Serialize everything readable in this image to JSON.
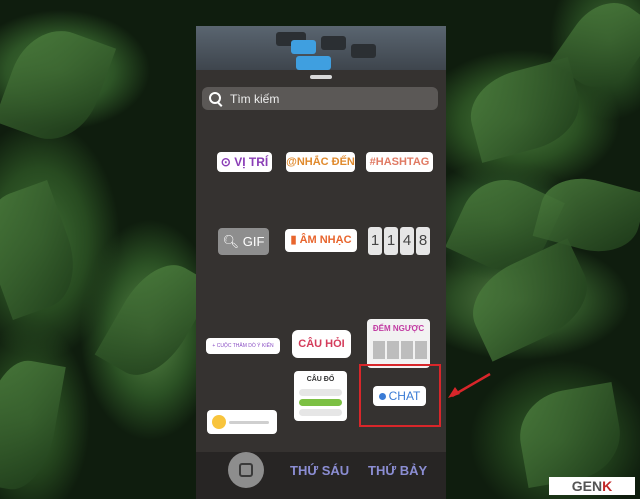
{
  "search": {
    "placeholder": "Tìm kiếm"
  },
  "stickers": {
    "location": "VỊ TRÍ",
    "mention": "@NHẮC ĐẾN",
    "hashtag": "#HASHTAG",
    "gif": "GIF",
    "music": "ÂM NHẠC",
    "countdown_digits": [
      "1",
      "1",
      "4",
      "8"
    ],
    "poll": "+ CUỘC THĂM DÒ Ý KIẾN",
    "question": "CÂU HỎI",
    "quiz_title": "ĐẾM NGƯỢC",
    "quiz2_title": "CÂU ĐỐ",
    "chat": "CHAT"
  },
  "bottom_bar": {
    "days": [
      "THỨ SÁU",
      "THỨ BẢY"
    ]
  },
  "watermark": {
    "brand_prefix": "GEN",
    "brand_k": "K"
  },
  "colors": {
    "highlight": "#d8262a",
    "chat_blue": "#3a7bd5",
    "location_purple": "#8a3db6"
  },
  "icons": [
    "search-icon",
    "location-pin-icon",
    "camera-icon",
    "chat-bubble-icon",
    "arrow-icon"
  ]
}
